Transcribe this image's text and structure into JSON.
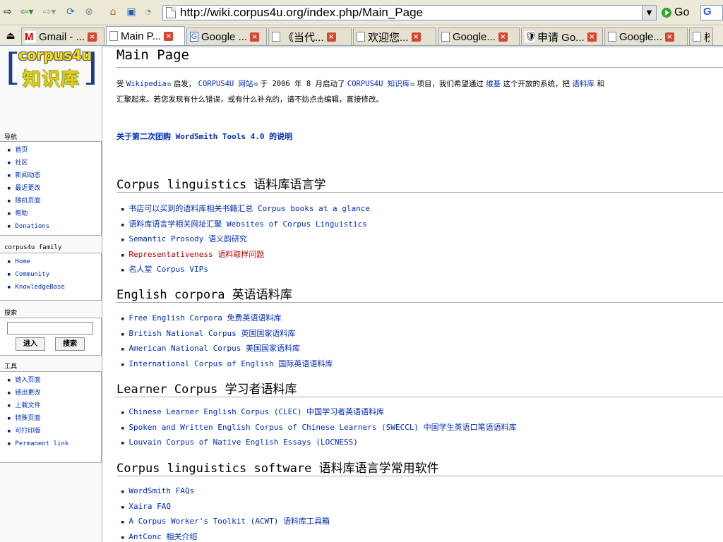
{
  "browser": {
    "url": "http://wiki.corpus4u.org/index.php/Main_Page",
    "go_label": "Go",
    "google_label": "G",
    "tabs": [
      {
        "label": "Gmail - ...",
        "favicon": "gmail",
        "active": false
      },
      {
        "label": "Main P...",
        "favicon": "page",
        "active": true
      },
      {
        "label": "Google ...",
        "favicon": "google",
        "active": false
      },
      {
        "label": "《当代...",
        "favicon": "page",
        "active": false
      },
      {
        "label": "欢迎您...",
        "favicon": "page",
        "active": false
      },
      {
        "label": "Google...",
        "favicon": "page",
        "active": false
      },
      {
        "label": "申请 Go...",
        "favicon": "shield",
        "active": false
      },
      {
        "label": "Google...",
        "favicon": "page",
        "active": false
      },
      {
        "label": "校",
        "favicon": "page",
        "active": false
      }
    ],
    "close_glyph": "×"
  },
  "logo": {
    "line1": "corpus4u",
    "line2": "知识库"
  },
  "sidebar": {
    "nav_title": "导航",
    "nav_items": [
      "首页",
      "社区",
      "新闻动态",
      "最近更改",
      "随机页面",
      "帮助",
      "Donations"
    ],
    "family_title": "corpus4u family",
    "family_items": [
      "Home",
      "Community",
      "KnowledgeBase"
    ],
    "search_title": "搜索",
    "search_go": "进入",
    "search_search": "搜索",
    "tools_title": "工具",
    "tools_items": [
      "链入页面",
      "链出更改",
      "上载文件",
      "特殊页面",
      "可打印版",
      "Permanent link"
    ]
  },
  "content": {
    "title": "Main Page",
    "intro": {
      "p1": "受",
      "wikipedia": "Wikipedia",
      "p2": "启发，",
      "corpus4u_site": "CORPUS4U 网站",
      "p3": "于 2006 年 8 月启动了",
      "kb": "CORPUS4U 知识库",
      "p4": "项目，我们希望通过",
      "wiki": "维基",
      "p5": "这个开放的系统，把",
      "corpus": "语料库",
      "p6": "和",
      "line2": "汇聚起来。若您发现有什么错误，或有什么补充的，请不妨点击编辑，直接修改。"
    },
    "notice": "关于第二次团购 WordSmith Tools 4.0 的说明",
    "sections": [
      {
        "heading": "Corpus linguistics 语料库语言学",
        "items": [
          "书店可以买到的语料库相关书籍汇总 Corpus books at a glance",
          "语料库语言学相关网址汇聚 Websites of Corpus Linguistics",
          "Semantic Prosody 语义韵研究",
          "Representativeness 语料取样问题",
          "名人堂 Corpus VIPs"
        ]
      },
      {
        "heading": "English corpora 英语语料库",
        "items": [
          "Free English Corpora 免费英语语料库",
          "British National Corpus 英国国家语料库",
          "American National Corpus 美国国家语料库",
          "International Corpus of English 国际英语语料库"
        ]
      },
      {
        "heading": "Learner Corpus 学习者语料库",
        "items": [
          "Chinese Learner English Corpus (CLEC) 中国学习者英语语料库",
          "Spoken and Written English Corpus of Chinese Learners (SWECCL) 中国学生英语口笔语语料库",
          "Louvain Corpus of Native English Essays (LOCNESS)"
        ]
      },
      {
        "heading": "Corpus linguistics software 语料库语言学常用软件",
        "items": [
          "WordSmith FAQs",
          "Xaira FAQ",
          "A Corpus Worker's Toolkit (ACWT) 语料库工具箱",
          "AntConc 相关介绍"
        ]
      }
    ]
  },
  "colors": {
    "link": "#002bb8",
    "redlink": "#ba0000",
    "chrome": "#ece9d8"
  }
}
